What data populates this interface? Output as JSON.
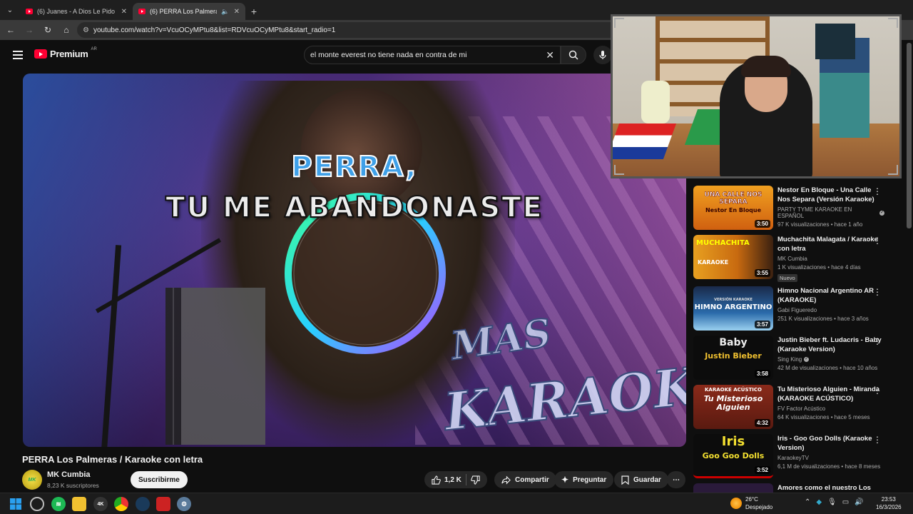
{
  "browser": {
    "tabs": [
      {
        "label": "(6) Juanes - A Dios Le Pido (Lyri",
        "active": false
      },
      {
        "label": "(6) PERRA Los Palmeras / K",
        "active": true
      }
    ],
    "url": "youtube.com/watch?v=VcuOCyMPtu8&list=RDVcuOCyMPtu8&start_radio=1"
  },
  "masthead": {
    "logo_text": "Premium",
    "country": "AR",
    "search_value": "el monte everest no tiene nada en contra de mi"
  },
  "video": {
    "lyric_line1": "PERRA,",
    "lyric_line2": "TU ME ABANDONASTE",
    "watermark_line1": "MAS",
    "watermark_line2": "KARAOKE",
    "title": "PERRA Los Palmeras / Karaoke con letra",
    "channel": "MK Cumbia",
    "channel_avatar_text": "MK",
    "subscribers": "8,23 K suscriptores",
    "subscribe_label": "Suscribirme",
    "likes": "1,2 K",
    "share_label": "Compartir",
    "ask_label": "Preguntar",
    "save_label": "Guardar"
  },
  "sidebar": {
    "items": [
      {
        "thumb_text": "UNA CALLE NOS SEPARA",
        "thumb_sub": "Nestor En Bloque",
        "duration": "3:50",
        "title": "Nestor En Bloque - Una Calle Nos Separa (Versión Karaoke)",
        "channel": "PARTY TYME KARAOKE EN ESPAÑOL",
        "verified": true,
        "stats": "97 K visualizaciones • hace 1 año",
        "badge": ""
      },
      {
        "thumb_text": "MUCHACHITA",
        "thumb_sub": "KARAOKE",
        "duration": "3:55",
        "title": "Muchachita Malagata / Karaoke con letra",
        "channel": "MK Cumbia",
        "verified": false,
        "stats": "1 K visualizaciones • hace 4 días",
        "badge": "Nuevo"
      },
      {
        "thumb_text": "HIMNO ARGENTINO",
        "thumb_sub": "VERSIÓN KARAOKE",
        "duration": "3:57",
        "title": "Himno Nacional Argentino AR (KARAOKE)",
        "channel": "Gabi Figueredo",
        "verified": false,
        "stats": "251 K visualizaciones • hace 3 años",
        "badge": ""
      },
      {
        "thumb_text": "Baby",
        "thumb_sub": "Justin Bieber",
        "duration": "3:58",
        "title": "Justin Bieber ft. Ludacris - Baby (Karaoke Version)",
        "channel": "Sing King",
        "verified": true,
        "stats": "42 M de visualizaciones • hace 10 años",
        "badge": ""
      },
      {
        "thumb_text": "Tu Misterioso Alguien",
        "thumb_sub": "KARAOKE ACÚSTICO",
        "duration": "4:32",
        "title": "Tu Misterioso Alguien - Miranda (KARAOKE ACÚSTICO)",
        "channel": "FV Factor Acústico",
        "verified": false,
        "stats": "64 K visualizaciones • hace 5 meses",
        "badge": ""
      },
      {
        "thumb_text": "Iris",
        "thumb_sub": "Goo Goo Dolls",
        "duration": "3:52",
        "title": "Iris - Goo Goo Dolls (Karaoke Version)",
        "channel": "KaraokeyTV",
        "verified": false,
        "stats": "6,1 M de visualizaciones • hace 8 meses",
        "badge": ""
      },
      {
        "thumb_text": "",
        "thumb_sub": "",
        "duration": "",
        "title": "Amores como el nuestro  Los",
        "channel": "",
        "verified": false,
        "stats": "",
        "badge": ""
      }
    ]
  },
  "taskbar": {
    "weather_temp": "26°C",
    "weather_desc": "Despejado",
    "time": "23:53",
    "date": "16/3/2026"
  },
  "colors": {
    "background": "#0f0f0f",
    "brand_red": "#ff0033",
    "lyric_blue": "#3fa0e8",
    "subscribe_bg": "#f1f1f1"
  }
}
